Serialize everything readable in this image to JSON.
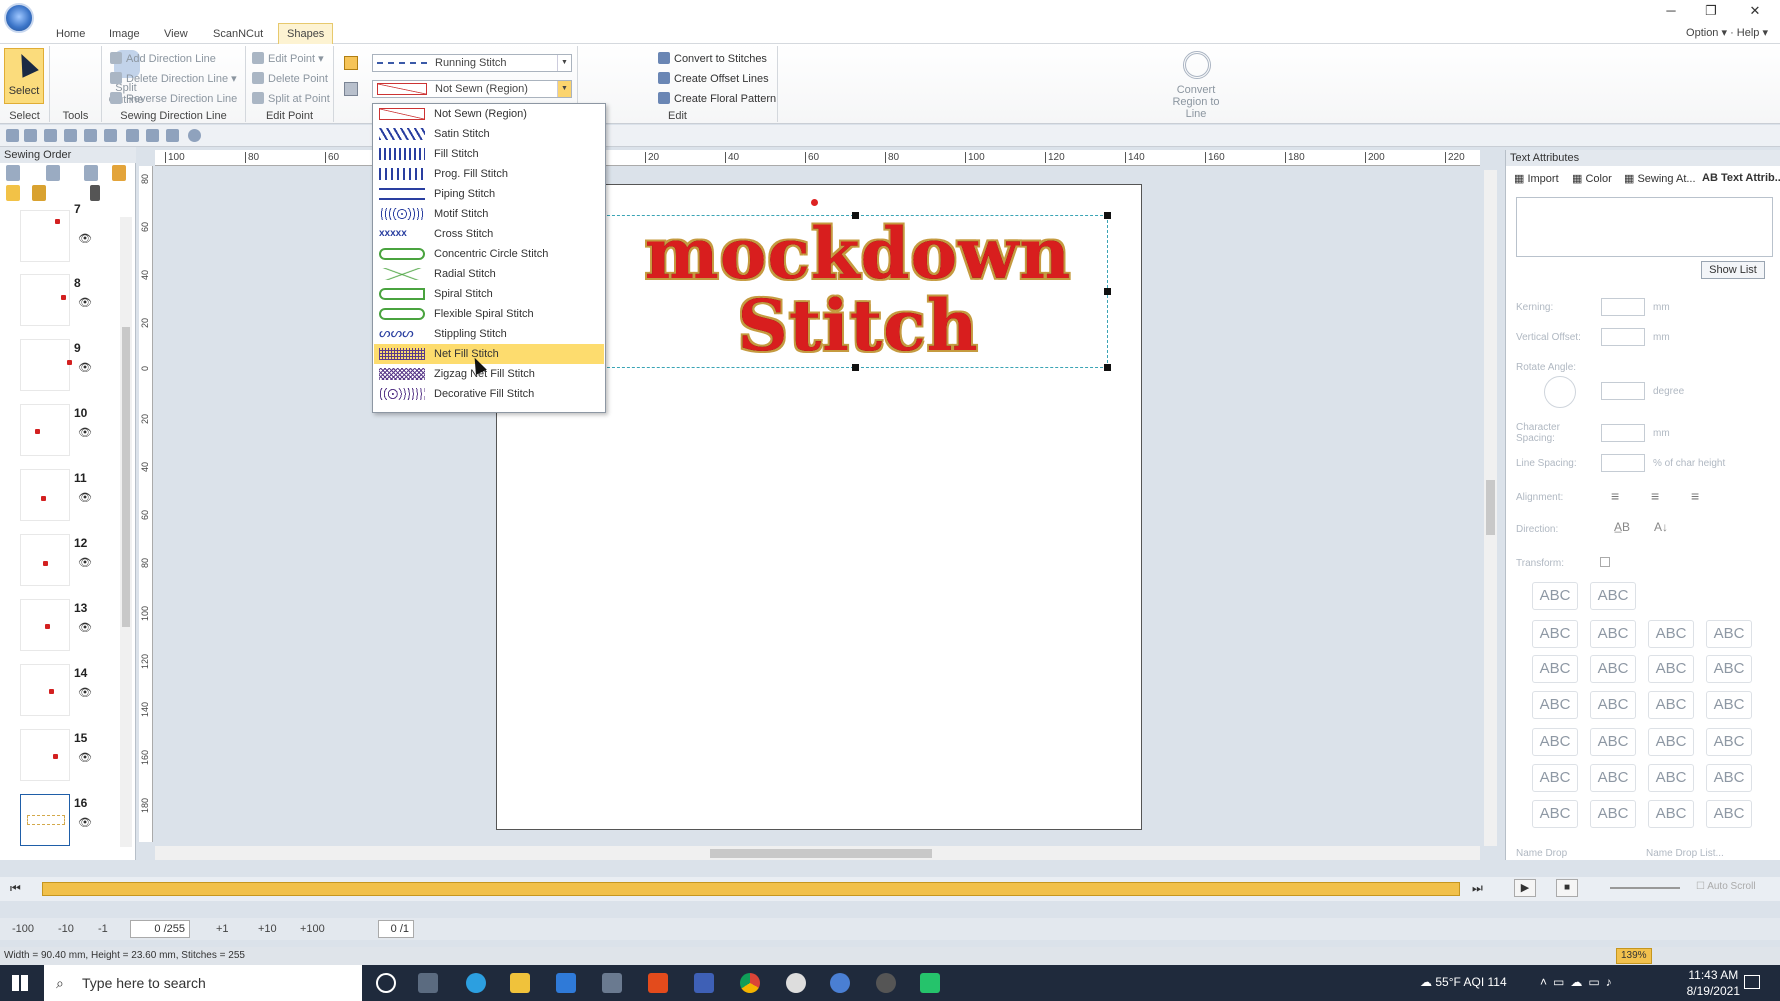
{
  "window": {
    "minimize": "─",
    "maximize": "❐",
    "close": "✕"
  },
  "tabs": [
    {
      "label": "Home"
    },
    {
      "label": "Image"
    },
    {
      "label": "View"
    },
    {
      "label": "ScanNCut"
    },
    {
      "label": "Shapes",
      "active": true
    }
  ],
  "menu_right": {
    "option": "Option",
    "help": "Help"
  },
  "ribbon": {
    "select": {
      "label": "Select",
      "group": "Select"
    },
    "tools": {
      "split_outline": "Split Outline",
      "group": "Tools"
    },
    "sewing_direction": {
      "add": "Add Direction Line",
      "delete": "Delete Direction Line",
      "reverse": "Reverse Direction Line",
      "group": "Sewing Direction Line"
    },
    "edit_point": {
      "edit": "Edit Point",
      "delete": "Delete Point",
      "split": "Split at Point",
      "group": "Edit Point"
    },
    "line_stitch": {
      "value": "Running Stitch"
    },
    "region_stitch": {
      "value": "Not Sewn (Region)"
    },
    "edit": {
      "convert_region": "Convert Region to Line",
      "convert_stitches": "Convert to Stitches",
      "offset": "Create Offset Lines",
      "floral": "Create Floral Pattern",
      "group": "Edit"
    }
  },
  "dropdown": {
    "items": [
      {
        "label": "Not Sewn (Region)",
        "icon": "not-sewn-icon"
      },
      {
        "label": "Satin Stitch",
        "icon": "satin-icon"
      },
      {
        "label": "Fill Stitch",
        "icon": "fill-icon"
      },
      {
        "label": "Prog. Fill Stitch",
        "icon": "prog-fill-icon"
      },
      {
        "label": "Piping Stitch",
        "icon": "piping-icon"
      },
      {
        "label": "Motif Stitch",
        "icon": "motif-icon"
      },
      {
        "label": "Cross Stitch",
        "icon": "cross-icon"
      },
      {
        "label": "Concentric Circle Stitch",
        "icon": "concentric-icon"
      },
      {
        "label": "Radial Stitch",
        "icon": "radial-icon"
      },
      {
        "label": "Spiral Stitch",
        "icon": "spiral-icon"
      },
      {
        "label": "Flexible Spiral Stitch",
        "icon": "flex-spiral-icon"
      },
      {
        "label": "Stippling Stitch",
        "icon": "stippling-icon"
      },
      {
        "label": "Net Fill Stitch",
        "icon": "net-fill-icon",
        "highlighted": true
      },
      {
        "label": "Zigzag Net Fill Stitch",
        "icon": "zigzag-net-icon"
      },
      {
        "label": "Decorative Fill Stitch",
        "icon": "decorative-fill-icon"
      }
    ]
  },
  "sewing_order": {
    "title": "Sewing Order",
    "items": [
      {
        "num": "7"
      },
      {
        "num": "8"
      },
      {
        "num": "9"
      },
      {
        "num": "10"
      },
      {
        "num": "11"
      },
      {
        "num": "12"
      },
      {
        "num": "13"
      },
      {
        "num": "14"
      },
      {
        "num": "15"
      },
      {
        "num": "16",
        "selected": true
      }
    ]
  },
  "canvas": {
    "line1": "mockdown",
    "line2": "Stitch",
    "text_color": "#d81e1e",
    "outline_color": "#c59b40",
    "ruler_h": [
      "100",
      "80",
      "60",
      "40",
      "20",
      "0",
      "20",
      "40",
      "60",
      "80",
      "100",
      "120",
      "140",
      "160",
      "180",
      "200",
      "220"
    ],
    "ruler_v": [
      "80",
      "60",
      "40",
      "20",
      "0",
      "20",
      "40",
      "60",
      "80",
      "100",
      "120",
      "140",
      "160",
      "180"
    ]
  },
  "text_attributes": {
    "title": "Text Attributes",
    "tabs": [
      "Import",
      "Color",
      "Sewing At...",
      "Text Attrib..."
    ],
    "show_list": "Show List",
    "fields": [
      {
        "label": "Kerning:",
        "unit": "mm"
      },
      {
        "label": "Vertical Offset:",
        "unit": "mm"
      },
      {
        "label": "Rotate Angle:",
        "unit": "degree"
      },
      {
        "label": "Character Spacing:",
        "unit": "mm"
      },
      {
        "label": "Line Spacing:",
        "unit": "% of char height"
      }
    ],
    "alignment": "Alignment:",
    "direction": "Direction:",
    "transform": "Transform:",
    "name_drop": "Name Drop",
    "name_drop_list": "Name Drop List...",
    "abc_sample": "ABC"
  },
  "bottom": {
    "steps": [
      "-100",
      "-10",
      "-1"
    ],
    "stitch_counter": "0 /255",
    "steps_fwd": [
      "+1",
      "+10",
      "+100"
    ],
    "color_counter": "0 /1",
    "auto_scroll": "Auto Scroll",
    "status": "Width = 90.40 mm, Height = 23.60 mm, Stitches = 255",
    "zoom": "139%"
  },
  "taskbar": {
    "search": "Type here to search",
    "weather": "55°F  AQI 114",
    "time": "11:43 AM",
    "date": "8/19/2021"
  }
}
